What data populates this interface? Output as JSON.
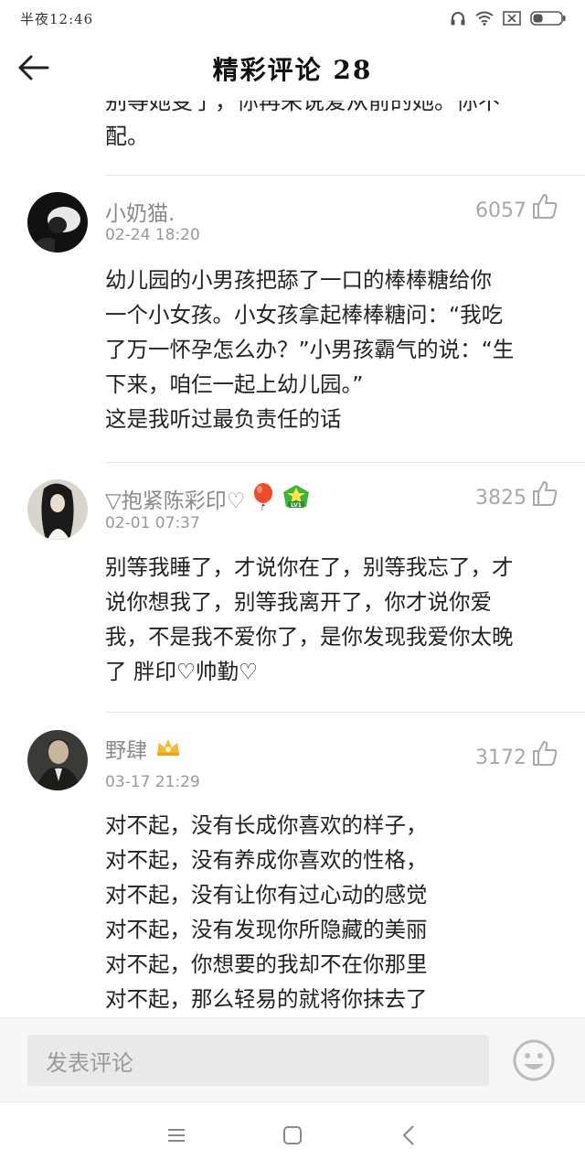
{
  "status": {
    "time": "半夜12:46"
  },
  "header": {
    "title": "精彩评论 28"
  },
  "partial_comment": {
    "line1": "别等她变了，你再来说爱从前的她。你不",
    "line2": "配。"
  },
  "comments": [
    {
      "username": "小奶猫.",
      "date": "02-24 18:20",
      "likes": "6057",
      "lines": [
        "幼儿园的小男孩把舔了一口的棒棒糖给你",
        "一个小女孩。小女孩拿起棒棒糖问：“我吃",
        "了万一怀孕怎么办？”小男孩霸气的说：“生",
        "下来，咱仨一起上幼儿园。”",
        "这是我听过最负责任的话"
      ]
    },
    {
      "username": "▽抱紧陈彩印♡",
      "date": "02-01 07:37",
      "likes": "3825",
      "badge_icon": "balloon-icon",
      "level_badge": "LV1",
      "lines": [
        "别等我睡了，才说你在了，别等我忘了，才",
        "说你想我了，别等我离开了，你才说你爱",
        "我，不是我不爱你了，是你发现我爱你太晚",
        "了 胖印♡帅勤♡"
      ]
    },
    {
      "username": "野肆",
      "date": "03-17 21:29",
      "likes": "3172",
      "badge_icon": "crown-icon",
      "lines": [
        "对不起，没有长成你喜欢的样子，",
        "对不起，没有养成你喜欢的性格，",
        "对不起，没有让你有过心动的感觉",
        "对不起，没有发现你所隐藏的美丽",
        "对不起，你想要的我却不在你那里",
        "对不起，那么轻易的就将你抹去了"
      ]
    }
  ],
  "input": {
    "placeholder": "发表评论"
  },
  "colors": {
    "accent_level": "#3bb53b",
    "balloon": "#f04a2a",
    "crown": "#f5b82e"
  }
}
